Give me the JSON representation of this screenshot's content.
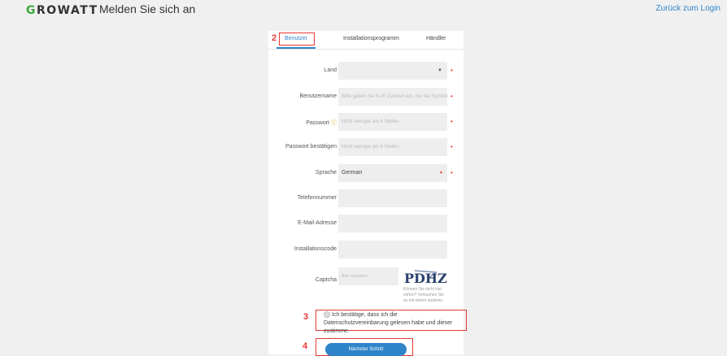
{
  "header": {
    "logo_prefix": "G",
    "logo_rest": "ROWATT",
    "title": "Melden Sie sich an",
    "back_link": "Zurück zum Login"
  },
  "tabs": [
    {
      "label": "Benutzer",
      "active": true
    },
    {
      "label": "Installationsprogramm",
      "active": false
    },
    {
      "label": "Händler",
      "active": false
    }
  ],
  "annotations": [
    "2",
    "3",
    "4"
  ],
  "form": {
    "country_label": "Land",
    "country_value": "",
    "username_label": "Benutzername",
    "username_placeholder": "Bitte geben Sie 6-30 Zeichen ein, nur die Symbole",
    "password_label": "Passwort",
    "password_placeholder": "Nicht weniger als 6 Stellen",
    "password_confirm_label": "Passwort bestätigen",
    "password_confirm_placeholder": "Nicht weniger als 6 Stellen",
    "language_label": "Sprache",
    "language_value": "German",
    "phone_label": "Telefonnummer",
    "email_label": "E-Mail-Adresse",
    "install_code_label": "Installationscode",
    "captcha_label": "Captcha",
    "captcha_placeholder": "Bitte eingeben",
    "captcha_text": "PDHZ",
    "captcha_hint": "Können Sie nicht klar sehen? Versuchen Sie es mit einem anderen.",
    "required_mark": "•"
  },
  "consent_text": "Ich bestätige, dass ich die Datenschutzvereinbarung gelesen habe und dieser zustimme.",
  "next_button": "Nächster Schritt",
  "colors": {
    "accent": "#2f84c9",
    "logo_green": "#3ba838",
    "annotation_red": "#e53935"
  }
}
